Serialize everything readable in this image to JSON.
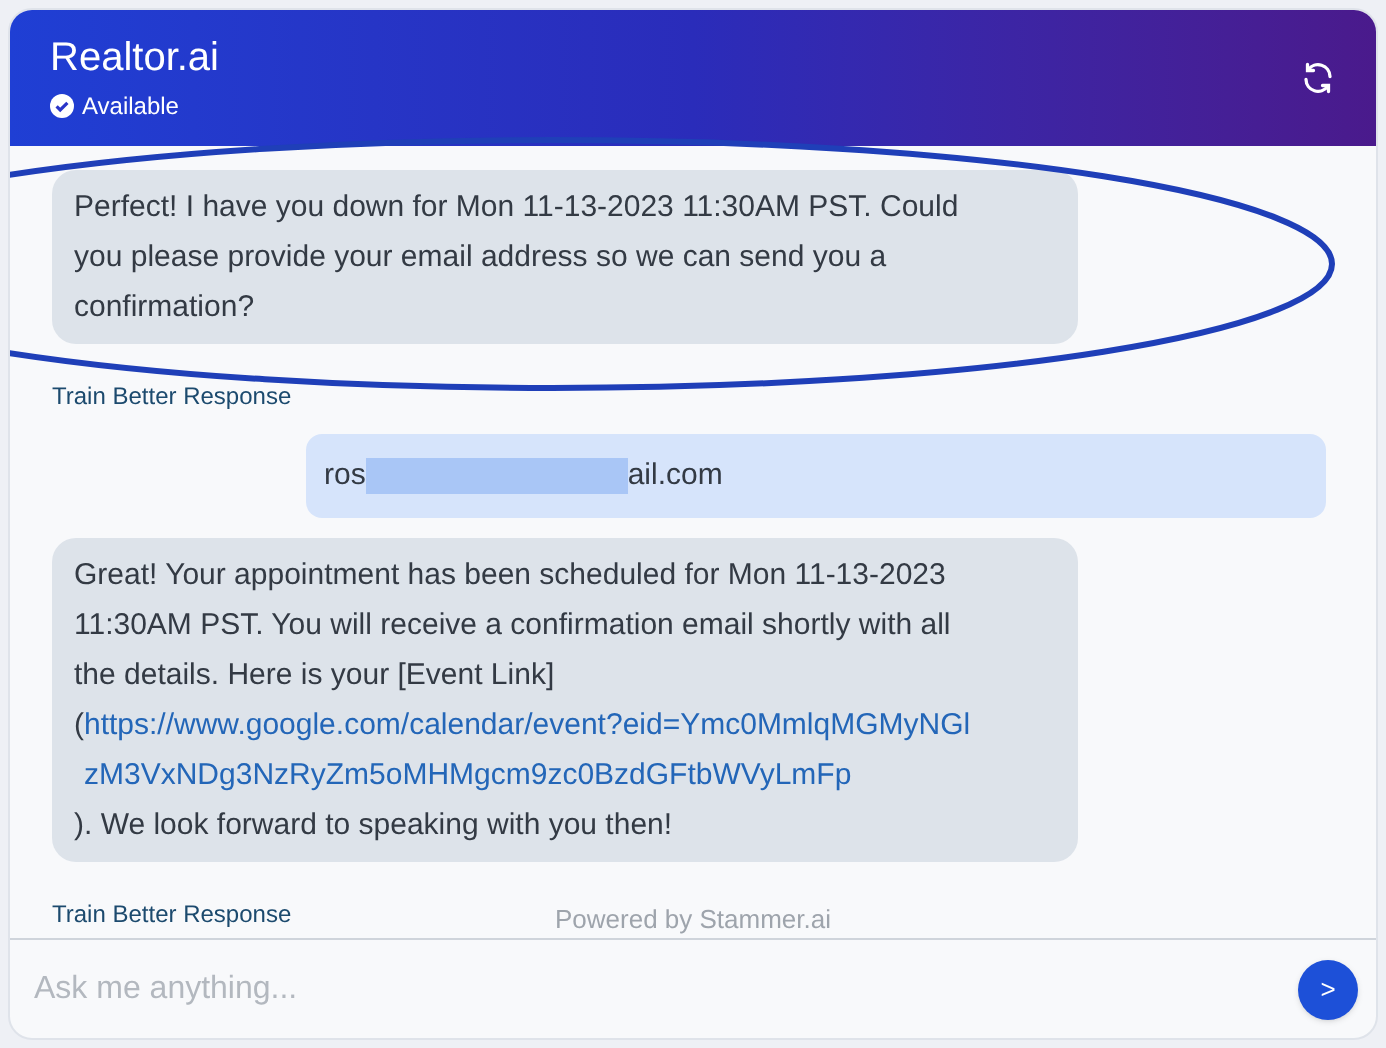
{
  "header": {
    "title": "Realtor.ai",
    "status": "Available"
  },
  "messages": [
    {
      "kind": "bot",
      "text": "Perfect! I have you down for Mon 11-13-2023 11:30AM PST. Could you please provide your email address so we can send you a confirmation?",
      "highlighted": true,
      "action": "Train Better Response"
    },
    {
      "kind": "user",
      "before": "ros",
      "after": "ail.com",
      "redacted": true
    },
    {
      "kind": "bot",
      "text": "Great! Your appointment has been scheduled for Mon 11-13-2023 11:30AM PST. You will receive a confirmation email shortly with all the details. Here is your [Event Link]",
      "open": "(",
      "link": "https://www.google.com/calendar/event?eid=Ymc0MmlqMGMyNGlzM3VxNDg3NzRyZm5oMHMgcm9zc0BzdGFtbWVyLmFp",
      "tail": "). We look forward to speaking with you then!",
      "highlighted": false,
      "action": "Train Better Response"
    }
  ],
  "footer": "Powered by Stammer.ai",
  "input": {
    "placeholder": "Ask me anything...",
    "send": ">"
  }
}
